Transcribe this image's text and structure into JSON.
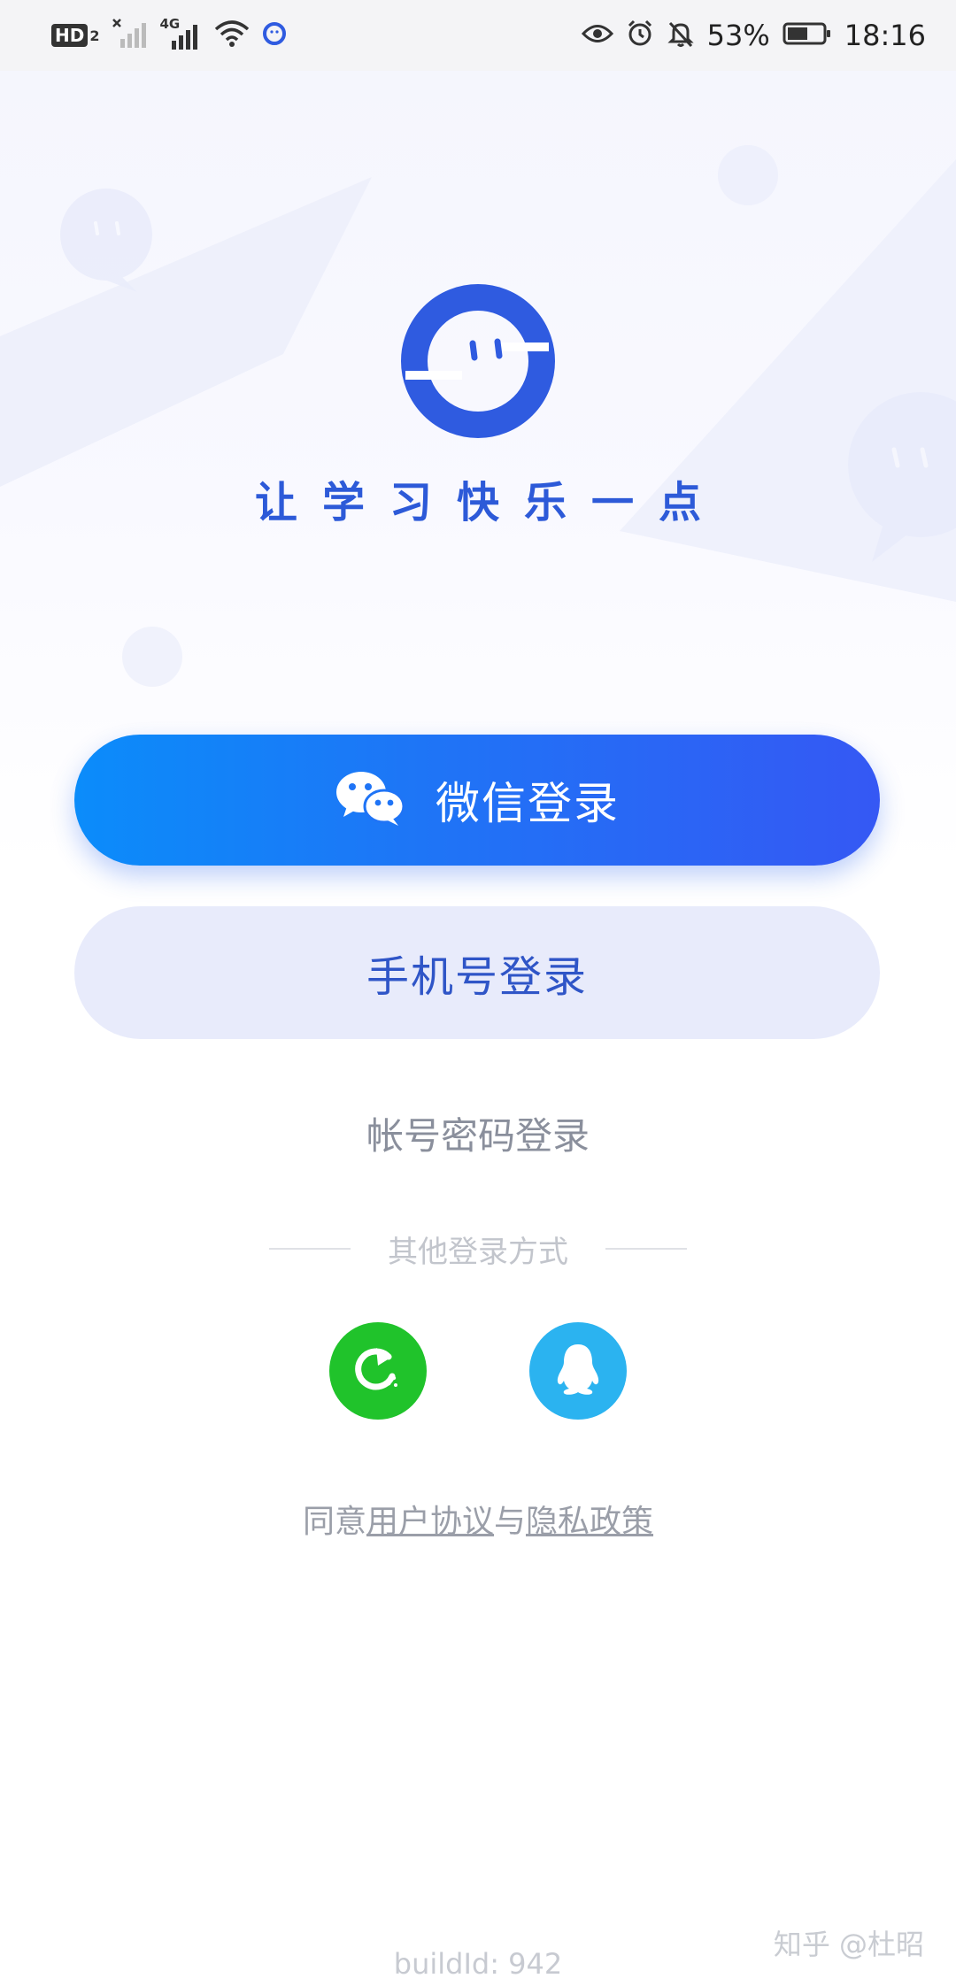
{
  "status_bar": {
    "hd_label": "HD",
    "hd_sub": "2",
    "network_label": "4G",
    "battery_text": "53%",
    "time": "18:16"
  },
  "brand": {
    "slogan": "让学习快乐一点"
  },
  "login": {
    "wechat_label": "微信登录",
    "phone_label": "手机号登录",
    "account_label": "帐号密码登录",
    "other_methods_label": "其他登录方式"
  },
  "agreement": {
    "prefix": "同意",
    "user_agreement": "用户协议",
    "and": "与",
    "privacy_policy": "隐私政策"
  },
  "footer": {
    "build_id": "buildId: 942",
    "watermark": "知乎 @杜昭"
  },
  "colors": {
    "brand_blue": "#2d5ad8",
    "wechat_gradient_start": "#0b8cfa",
    "wechat_gradient_end": "#3558f4",
    "phone_button_bg": "#e8ebfb",
    "green_app": "#20c32b",
    "qq_blue": "#2bb3f0"
  }
}
